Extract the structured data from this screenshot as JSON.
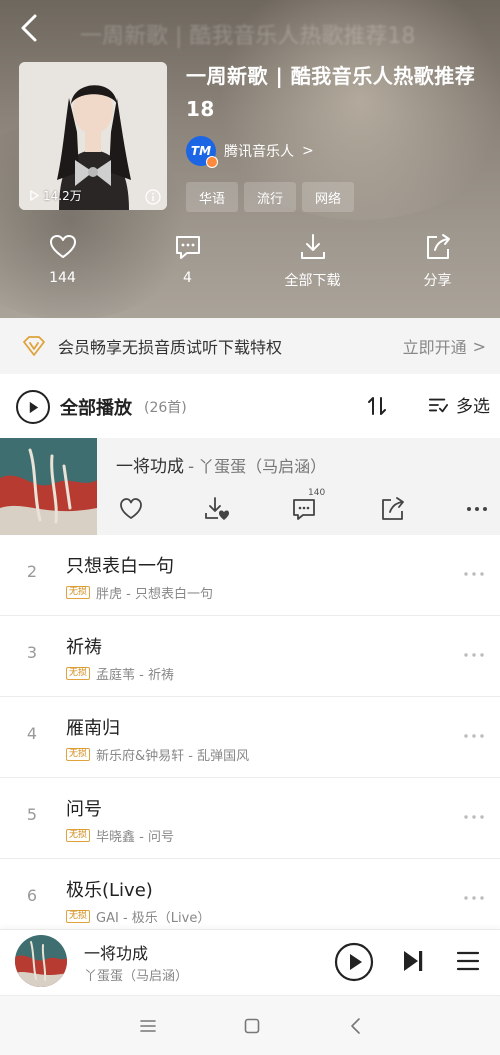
{
  "header": {
    "faint_title": "一周新歌 | 酷我音乐人热歌推荐18",
    "playlist_title": "一周新歌 | 酷我音乐人热歌推荐18",
    "play_count": "14.2万",
    "creator": {
      "name": "腾讯音乐人",
      "chevron": ">",
      "avatar_text": "TM"
    },
    "tags": [
      "华语",
      "流行",
      "网络"
    ],
    "actions": [
      {
        "icon": "heart-icon",
        "label": "144"
      },
      {
        "icon": "comment-icon",
        "label": "4"
      },
      {
        "icon": "download-icon",
        "label": "全部下载"
      },
      {
        "icon": "share-icon",
        "label": "分享"
      }
    ]
  },
  "vip_bar": {
    "text": "会员畅享无损音质试听下载特权",
    "cta": "立即开通",
    "chevron": ">",
    "accent": "#e0a23c"
  },
  "play_all": {
    "label": "全部播放",
    "count": "(26首)",
    "multi_select": "多选"
  },
  "current_song": {
    "title": "一将功成",
    "separator": "-",
    "artist": "丫蛋蛋（马启涵）",
    "comment_count": "140"
  },
  "songs": [
    {
      "num": "2",
      "title": "只想表白一句",
      "badge": "无损",
      "subtitle": "胖虎 - 只想表白一句"
    },
    {
      "num": "3",
      "title": "祈祷",
      "badge": "无损",
      "subtitle": "孟庭苇 - 祈祷"
    },
    {
      "num": "4",
      "title": "雁南归",
      "badge": "无损",
      "subtitle": "新乐府&钟易轩 - 乱弹国风"
    },
    {
      "num": "5",
      "title": "问号",
      "badge": "无损",
      "subtitle": "毕晓鑫 - 问号"
    },
    {
      "num": "6",
      "title": "极乐(Live)",
      "badge": "无损",
      "subtitle": "GAI - 极乐（Live）"
    }
  ],
  "mini_player": {
    "title": "一将功成",
    "artist": "丫蛋蛋（马启涵）"
  },
  "colors": {
    "header_bg": "#8a8278",
    "vip_bg": "#f4f4f4",
    "current_bg": "#f3f3f3",
    "badge": "#e0a23c"
  }
}
